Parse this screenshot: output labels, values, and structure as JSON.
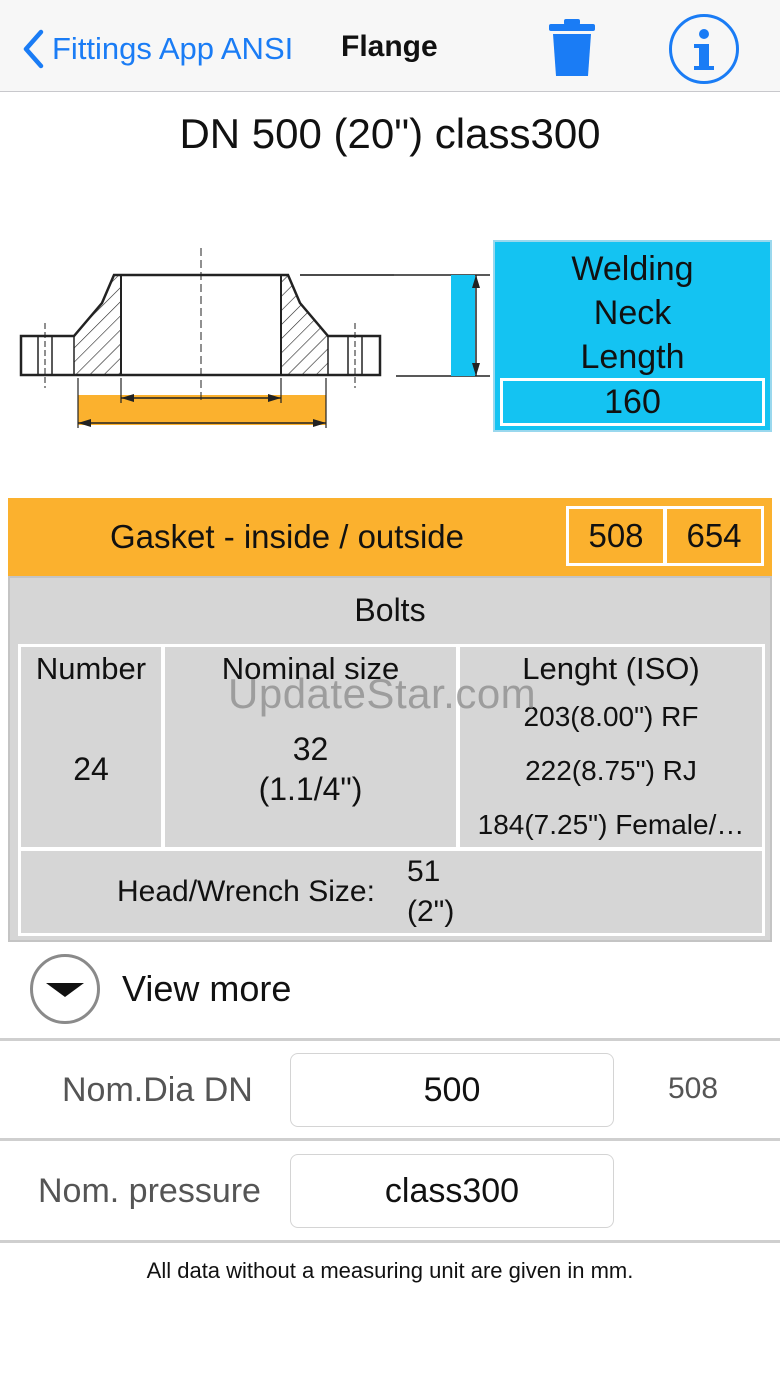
{
  "navbar": {
    "back_label": "Fittings App ANSI",
    "title": "Flange",
    "accent": "#1a7cf5"
  },
  "title": "DN 500 (20\")  class300",
  "welding_neck": {
    "label_lines": [
      "Welding",
      "Neck",
      "Length"
    ],
    "value": "160",
    "color": "#14c3f2"
  },
  "gasket": {
    "label": "Gasket - inside / outside",
    "inside": "508",
    "outside": "654",
    "color": "#fbb12e"
  },
  "bolts": {
    "title": "Bolts",
    "number_header": "Number",
    "number_value": "24",
    "nominal_header": "Nominal size",
    "nominal_value": "32",
    "nominal_inch": "(1.1/4\")",
    "length_header": "Lenght (ISO)",
    "lengths": [
      "203(8.00\") RF",
      "222(8.75\") RJ",
      "184(7.25\") Female/…"
    ],
    "head_label": "Head/Wrench Size:",
    "head_value": "51",
    "head_inch": "(2\")"
  },
  "watermark": "UpdateStar.com",
  "view_more": "View more",
  "nom_dia": {
    "label": "Nom.Dia DN",
    "value": "500",
    "side": "508"
  },
  "nom_pressure": {
    "label": "Nom. pressure",
    "value": "class300"
  },
  "footer": "All data without a measuring unit are given in mm."
}
